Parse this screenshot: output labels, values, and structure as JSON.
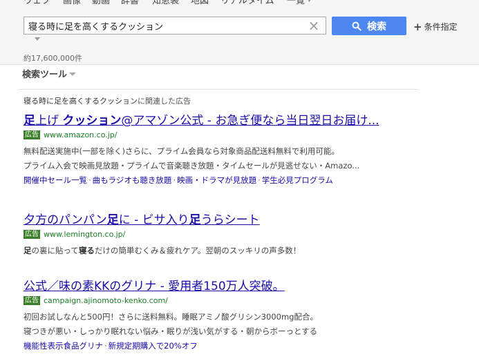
{
  "tabs": [
    "ウェブ",
    "画像",
    "動画",
    "辞書",
    "知恵袋",
    "地図",
    "リアルタイム",
    "一覧"
  ],
  "search": {
    "query": "寝る時に足を高くするクッション",
    "button_label": "検索",
    "conditions_label": "条件指定"
  },
  "result_count": "約17,600,000件",
  "search_tools_label": "検索ツール",
  "ad_heading": {
    "query": "寝る時に足を高くするクッション",
    "suffix": "に関連した広告"
  },
  "ad_badge": "広告",
  "ads": [
    {
      "title_parts": [
        {
          "text": "足",
          "bold": true
        },
        {
          "text": "上げ ",
          "bold": false
        },
        {
          "text": "クッション",
          "bold": true
        },
        {
          "text": "@アマゾン公式 - お急ぎ便なら当日翌日お届け...",
          "bold": false
        }
      ],
      "url": "www.amazon.co.jp/",
      "desc_lines": [
        "無料配送実施中(一部を除く)さらに、プライム会員なら対象商品配送料無料で利用可能。",
        "プライム入会で映画見放題・プライムで音楽聴き放題・タイムセールが見逃せない・Amazo..."
      ],
      "sitelinks": [
        "開催中セール一覧",
        "曲もラジオも聴き放題",
        "映画・ドラマが見放題",
        "学生必見プログラム"
      ]
    },
    {
      "title_parts": [
        {
          "text": "夕方のパンパン",
          "bold": false
        },
        {
          "text": "足",
          "bold": true
        },
        {
          "text": "に - ビサ入り",
          "bold": false
        },
        {
          "text": "足",
          "bold": true
        },
        {
          "text": "うらシート",
          "bold": false
        }
      ],
      "url": "www.lemington.co.jp/",
      "desc_parts": [
        {
          "text": "足",
          "bold": true
        },
        {
          "text": "の裏に貼って",
          "bold": false
        },
        {
          "text": "寝る",
          "bold": true
        },
        {
          "text": "だけの簡単むくみ＆疲れケア。翌朝のスッキリの声多数！",
          "bold": false
        }
      ]
    },
    {
      "title_parts": [
        {
          "text": "公式／味の素KKのグリナ - 愛用者150万人突破。",
          "bold": false
        }
      ],
      "url": "campaign.ajinomoto-kenko.com/",
      "desc_lines": [
        "初回お試しなんと500円！さらに送料無料。睡眠アミノ酸グリシン3000mg配合。",
        "寝つきが悪い・しっかり眠れない悩み・眠りが浅い気がする・朝からボーっとする"
      ],
      "sitelinks": [
        "機能性表示食品グリナ",
        "新規定期購入で20%オフ"
      ]
    }
  ],
  "colors": {
    "link": "#1a0dab",
    "url_green": "#1c7e27",
    "badge_green": "#398028",
    "search_button": "#4d87f0"
  }
}
